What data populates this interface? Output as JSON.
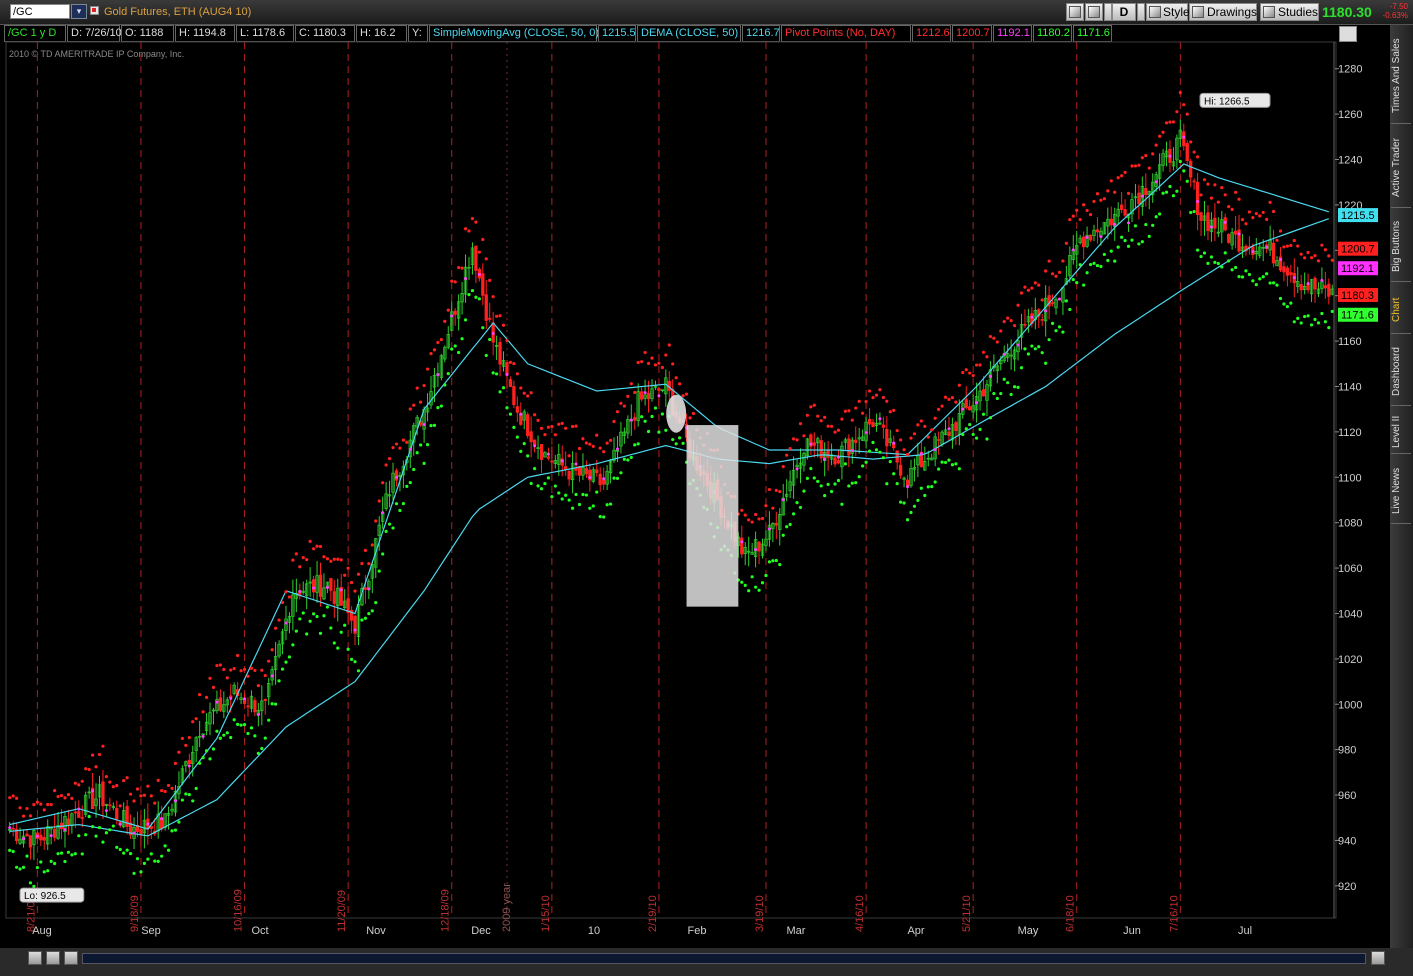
{
  "toolbar": {
    "symbol": "/GC",
    "description": "Gold Futures, ETH (AUG4 10)",
    "buttons": [
      "D",
      "Style",
      "Drawings",
      "Studies"
    ],
    "last": "1180.30",
    "change_lines": [
      "-7.50",
      "-0.63%"
    ]
  },
  "info": {
    "cells": [
      {
        "text": "/GC 1 y D",
        "color": "#2ee02e"
      },
      {
        "text": "D: 7/26/10",
        "color": "#dddddd"
      },
      {
        "text": "O: 1188",
        "color": "#dddddd"
      },
      {
        "text": "H: 1194.8",
        "color": "#dddddd"
      },
      {
        "text": "L: 1178.6",
        "color": "#dddddd"
      },
      {
        "text": "C: 1180.3",
        "color": "#dddddd"
      },
      {
        "text": "H: 16.2",
        "color": "#dddddd"
      },
      {
        "text": "Y:",
        "color": "#dddddd"
      },
      {
        "text": "SimpleMovingAvg (CLOSE, 50, 0)",
        "color": "#4cd8f0"
      },
      {
        "text": "1215.5",
        "color": "#4cd8f0"
      },
      {
        "text": "DEMA (CLOSE, 50)",
        "color": "#4cd8f0"
      },
      {
        "text": "1216.7",
        "color": "#4cd8f0"
      },
      {
        "text": "Pivot Points (No, DAY)",
        "color": "#ff3030"
      },
      {
        "text": "1212.6",
        "color": "#ff3030"
      },
      {
        "text": "1200.7",
        "color": "#ff3030"
      },
      {
        "text": "1192.1",
        "color": "#ff40ff"
      },
      {
        "text": "1180.2",
        "color": "#30ff30"
      },
      {
        "text": "1171.6",
        "color": "#30ff30"
      }
    ],
    "copyright": "2010 © TD AMERITRADE IP Company, Inc."
  },
  "side_tabs": [
    "Times And Sales",
    "Active Trader",
    "Big Buttons",
    "Chart",
    "Dashboard",
    "Level II",
    "Live News"
  ],
  "chart_data": {
    "type": "candlestick",
    "symbol": "/GC",
    "ylim": [
      912,
      1290
    ],
    "y_ticks": [
      920,
      940,
      960,
      980,
      1000,
      1020,
      1040,
      1060,
      1080,
      1100,
      1120,
      1140,
      1160,
      1180,
      1200,
      1220,
      1240,
      1260,
      1280
    ],
    "month_labels": [
      "Aug",
      "Sep",
      "Oct",
      "Nov",
      "Dec",
      "10",
      "Feb",
      "Mar",
      "Apr",
      "May",
      "Jun",
      "Jul"
    ],
    "date_markers": [
      "8/21/09",
      "9/18/09",
      "10/16/09",
      "11/20/09",
      "12/18/09",
      "1/15/10",
      "2/19/10",
      "3/19/10",
      "4/16/10",
      "5/21/10",
      "6/18/10",
      "7/16/10"
    ],
    "year_marker": "2009 year",
    "annotations": {
      "high": "Hi: 1266.5",
      "low": "Lo: 926.5"
    },
    "series": [
      {
        "name": "SimpleMovingAvg (CLOSE, 50, 0)",
        "last": "1215.5",
        "color": "#4cd8f0"
      },
      {
        "name": "DEMA (CLOSE, 50)",
        "last": "1216.7",
        "color": "#4cd8f0"
      }
    ],
    "close_path": [
      [
        0,
        945
      ],
      [
        8,
        940
      ],
      [
        17,
        950
      ],
      [
        26,
        960
      ],
      [
        35,
        945
      ],
      [
        45,
        948
      ],
      [
        55,
        990
      ],
      [
        65,
        1005
      ],
      [
        74,
        998
      ],
      [
        82,
        1050
      ],
      [
        92,
        1053
      ],
      [
        100,
        1035
      ],
      [
        110,
        1095
      ],
      [
        120,
        1130
      ],
      [
        128,
        1170
      ],
      [
        134,
        1202
      ],
      [
        140,
        1160
      ],
      [
        147,
        1130
      ],
      [
        155,
        1110
      ],
      [
        163,
        1102
      ],
      [
        172,
        1097
      ],
      [
        182,
        1133
      ],
      [
        190,
        1140
      ],
      [
        197,
        1112
      ],
      [
        205,
        1090
      ],
      [
        213,
        1065
      ],
      [
        220,
        1075
      ],
      [
        230,
        1115
      ],
      [
        240,
        1110
      ],
      [
        250,
        1125
      ],
      [
        260,
        1100
      ],
      [
        270,
        1117
      ],
      [
        280,
        1135
      ],
      [
        290,
        1158
      ],
      [
        300,
        1175
      ],
      [
        305,
        1185
      ],
      [
        310,
        1205
      ],
      [
        320,
        1215
      ],
      [
        330,
        1230
      ],
      [
        339,
        1248
      ],
      [
        345,
        1215
      ],
      [
        355,
        1205
      ],
      [
        365,
        1200
      ],
      [
        375,
        1185
      ],
      [
        384,
        1180
      ]
    ],
    "sma50_path": [
      [
        0,
        944
      ],
      [
        20,
        947
      ],
      [
        40,
        942
      ],
      [
        60,
        958
      ],
      [
        80,
        990
      ],
      [
        100,
        1010
      ],
      [
        120,
        1050
      ],
      [
        135,
        1085
      ],
      [
        150,
        1100
      ],
      [
        170,
        1106
      ],
      [
        190,
        1114
      ],
      [
        205,
        1108
      ],
      [
        220,
        1106
      ],
      [
        235,
        1110
      ],
      [
        250,
        1108
      ],
      [
        265,
        1110
      ],
      [
        280,
        1123
      ],
      [
        300,
        1140
      ],
      [
        320,
        1163
      ],
      [
        340,
        1183
      ],
      [
        360,
        1202
      ],
      [
        384,
        1215
      ]
    ],
    "dema50_path": [
      [
        0,
        947
      ],
      [
        20,
        954
      ],
      [
        40,
        945
      ],
      [
        60,
        985
      ],
      [
        80,
        1050
      ],
      [
        100,
        1040
      ],
      [
        120,
        1130
      ],
      [
        140,
        1168
      ],
      [
        150,
        1150
      ],
      [
        170,
        1138
      ],
      [
        190,
        1141
      ],
      [
        205,
        1122
      ],
      [
        220,
        1112
      ],
      [
        240,
        1112
      ],
      [
        260,
        1110
      ],
      [
        280,
        1140
      ],
      [
        300,
        1175
      ],
      [
        320,
        1210
      ],
      [
        340,
        1238
      ],
      [
        350,
        1232
      ],
      [
        384,
        1216
      ]
    ],
    "pivots_last": {
      "R2": "1212.6",
      "R1": "1200.7",
      "PP": "1192.1",
      "S1": "1180.2",
      "S2": "1171.6"
    },
    "price_badges": [
      {
        "label": "1215.5",
        "value": 1215.5,
        "bg": "#40e0f0",
        "fg": "#000000"
      },
      {
        "label": "1200.7",
        "value": 1200.7,
        "bg": "#ff2020",
        "fg": "#000000"
      },
      {
        "label": "1192.1",
        "value": 1192.1,
        "bg": "#ff30ff",
        "fg": "#000000"
      },
      {
        "label": "1180.3",
        "value": 1180.3,
        "bg": "#ff2020",
        "fg": "#000000"
      },
      {
        "label": "1171.6",
        "value": 1171.6,
        "bg": "#30ff30",
        "fg": "#000000"
      }
    ]
  }
}
